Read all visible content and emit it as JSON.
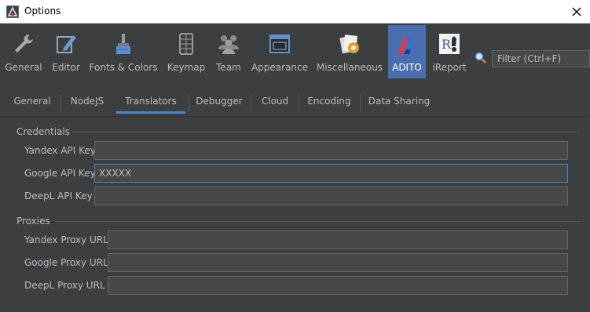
{
  "window": {
    "title": "Options"
  },
  "categories": [
    {
      "label": "General",
      "icon": "wrench-icon"
    },
    {
      "label": "Editor",
      "icon": "pencil-icon"
    },
    {
      "label": "Fonts & Colors",
      "icon": "paint-brush-icon"
    },
    {
      "label": "Keymap",
      "icon": "keyboard-icon"
    },
    {
      "label": "Team",
      "icon": "team-icon"
    },
    {
      "label": "Appearance",
      "icon": "appearance-icon"
    },
    {
      "label": "Miscellaneous",
      "icon": "miscellaneous-icon"
    },
    {
      "label": "ADITO",
      "icon": "adito-logo-icon",
      "selected": true
    },
    {
      "label": "iReport",
      "icon": "ireport-icon"
    }
  ],
  "filter": {
    "placeholder": "Filter (Ctrl+F)"
  },
  "subtabs": [
    {
      "label": "General"
    },
    {
      "label": "NodeJS"
    },
    {
      "label": "Translators",
      "active": true
    },
    {
      "label": "Debugger"
    },
    {
      "label": "Cloud"
    },
    {
      "label": "Encoding"
    },
    {
      "label": "Data Sharing"
    }
  ],
  "credentials": {
    "title": "Credentials",
    "yandex_label": "Yandex API Key",
    "yandex_value": "",
    "google_label": "Google API Key",
    "google_value": "XXXXX",
    "deepl_label": "DeepL  API Key",
    "deepl_value": ""
  },
  "proxies": {
    "title": "Proxies",
    "yandex_label": "Yandex Proxy URL",
    "yandex_value": "",
    "google_label": "Google Proxy URL",
    "google_value": "",
    "deepl_label": "DeepL  Proxy URL",
    "deepl_value": ""
  },
  "colors": {
    "selected_category": "#4b6eaf",
    "active_tab_underline": "#4a88c7",
    "background": "#3c3f41"
  }
}
